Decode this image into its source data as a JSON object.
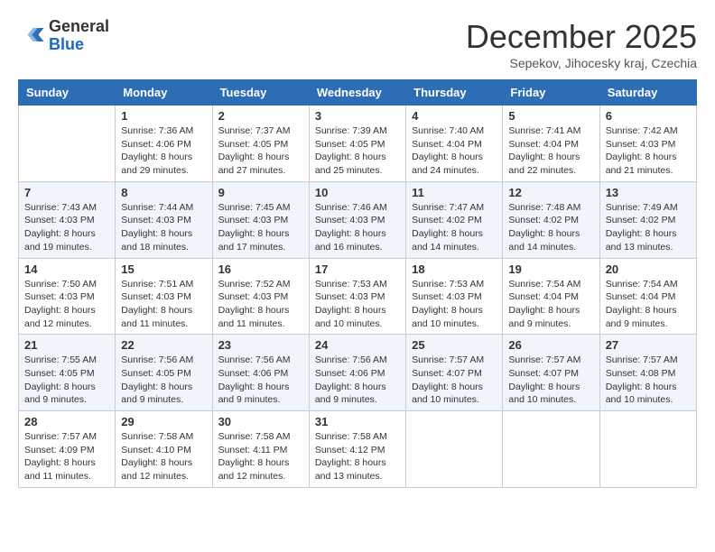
{
  "header": {
    "logo_line1": "General",
    "logo_line2": "Blue",
    "month_title": "December 2025",
    "subtitle": "Sepekov, Jihocesky kraj, Czechia"
  },
  "calendar": {
    "weekdays": [
      "Sunday",
      "Monday",
      "Tuesday",
      "Wednesday",
      "Thursday",
      "Friday",
      "Saturday"
    ],
    "weeks": [
      [
        {
          "day": "",
          "info": ""
        },
        {
          "day": "1",
          "info": "Sunrise: 7:36 AM\nSunset: 4:06 PM\nDaylight: 8 hours\nand 29 minutes."
        },
        {
          "day": "2",
          "info": "Sunrise: 7:37 AM\nSunset: 4:05 PM\nDaylight: 8 hours\nand 27 minutes."
        },
        {
          "day": "3",
          "info": "Sunrise: 7:39 AM\nSunset: 4:05 PM\nDaylight: 8 hours\nand 25 minutes."
        },
        {
          "day": "4",
          "info": "Sunrise: 7:40 AM\nSunset: 4:04 PM\nDaylight: 8 hours\nand 24 minutes."
        },
        {
          "day": "5",
          "info": "Sunrise: 7:41 AM\nSunset: 4:04 PM\nDaylight: 8 hours\nand 22 minutes."
        },
        {
          "day": "6",
          "info": "Sunrise: 7:42 AM\nSunset: 4:03 PM\nDaylight: 8 hours\nand 21 minutes."
        }
      ],
      [
        {
          "day": "7",
          "info": "Sunrise: 7:43 AM\nSunset: 4:03 PM\nDaylight: 8 hours\nand 19 minutes."
        },
        {
          "day": "8",
          "info": "Sunrise: 7:44 AM\nSunset: 4:03 PM\nDaylight: 8 hours\nand 18 minutes."
        },
        {
          "day": "9",
          "info": "Sunrise: 7:45 AM\nSunset: 4:03 PM\nDaylight: 8 hours\nand 17 minutes."
        },
        {
          "day": "10",
          "info": "Sunrise: 7:46 AM\nSunset: 4:03 PM\nDaylight: 8 hours\nand 16 minutes."
        },
        {
          "day": "11",
          "info": "Sunrise: 7:47 AM\nSunset: 4:02 PM\nDaylight: 8 hours\nand 14 minutes."
        },
        {
          "day": "12",
          "info": "Sunrise: 7:48 AM\nSunset: 4:02 PM\nDaylight: 8 hours\nand 14 minutes."
        },
        {
          "day": "13",
          "info": "Sunrise: 7:49 AM\nSunset: 4:02 PM\nDaylight: 8 hours\nand 13 minutes."
        }
      ],
      [
        {
          "day": "14",
          "info": "Sunrise: 7:50 AM\nSunset: 4:03 PM\nDaylight: 8 hours\nand 12 minutes."
        },
        {
          "day": "15",
          "info": "Sunrise: 7:51 AM\nSunset: 4:03 PM\nDaylight: 8 hours\nand 11 minutes."
        },
        {
          "day": "16",
          "info": "Sunrise: 7:52 AM\nSunset: 4:03 PM\nDaylight: 8 hours\nand 11 minutes."
        },
        {
          "day": "17",
          "info": "Sunrise: 7:53 AM\nSunset: 4:03 PM\nDaylight: 8 hours\nand 10 minutes."
        },
        {
          "day": "18",
          "info": "Sunrise: 7:53 AM\nSunset: 4:03 PM\nDaylight: 8 hours\nand 10 minutes."
        },
        {
          "day": "19",
          "info": "Sunrise: 7:54 AM\nSunset: 4:04 PM\nDaylight: 8 hours\nand 9 minutes."
        },
        {
          "day": "20",
          "info": "Sunrise: 7:54 AM\nSunset: 4:04 PM\nDaylight: 8 hours\nand 9 minutes."
        }
      ],
      [
        {
          "day": "21",
          "info": "Sunrise: 7:55 AM\nSunset: 4:05 PM\nDaylight: 8 hours\nand 9 minutes."
        },
        {
          "day": "22",
          "info": "Sunrise: 7:56 AM\nSunset: 4:05 PM\nDaylight: 8 hours\nand 9 minutes."
        },
        {
          "day": "23",
          "info": "Sunrise: 7:56 AM\nSunset: 4:06 PM\nDaylight: 8 hours\nand 9 minutes."
        },
        {
          "day": "24",
          "info": "Sunrise: 7:56 AM\nSunset: 4:06 PM\nDaylight: 8 hours\nand 9 minutes."
        },
        {
          "day": "25",
          "info": "Sunrise: 7:57 AM\nSunset: 4:07 PM\nDaylight: 8 hours\nand 10 minutes."
        },
        {
          "day": "26",
          "info": "Sunrise: 7:57 AM\nSunset: 4:07 PM\nDaylight: 8 hours\nand 10 minutes."
        },
        {
          "day": "27",
          "info": "Sunrise: 7:57 AM\nSunset: 4:08 PM\nDaylight: 8 hours\nand 10 minutes."
        }
      ],
      [
        {
          "day": "28",
          "info": "Sunrise: 7:57 AM\nSunset: 4:09 PM\nDaylight: 8 hours\nand 11 minutes."
        },
        {
          "day": "29",
          "info": "Sunrise: 7:58 AM\nSunset: 4:10 PM\nDaylight: 8 hours\nand 12 minutes."
        },
        {
          "day": "30",
          "info": "Sunrise: 7:58 AM\nSunset: 4:11 PM\nDaylight: 8 hours\nand 12 minutes."
        },
        {
          "day": "31",
          "info": "Sunrise: 7:58 AM\nSunset: 4:12 PM\nDaylight: 8 hours\nand 13 minutes."
        },
        {
          "day": "",
          "info": ""
        },
        {
          "day": "",
          "info": ""
        },
        {
          "day": "",
          "info": ""
        }
      ]
    ]
  }
}
